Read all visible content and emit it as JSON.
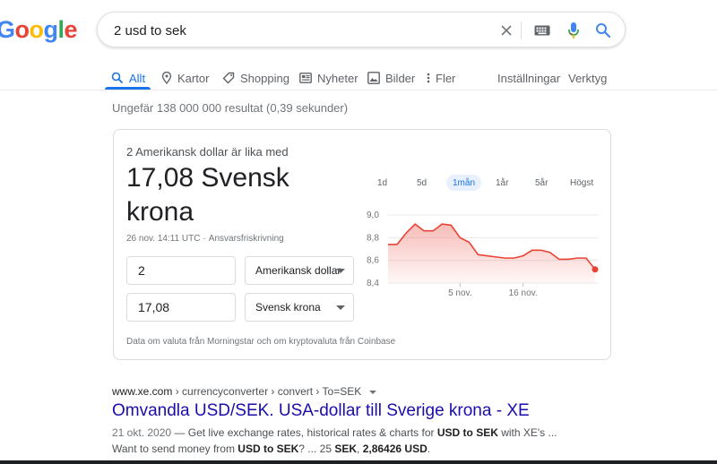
{
  "search": {
    "query": "2 usd to sek"
  },
  "tabs": [
    {
      "label": "Allt",
      "icon": "search-icon",
      "active": true
    },
    {
      "label": "Kartor",
      "icon": "map-pin-icon"
    },
    {
      "label": "Shopping",
      "icon": "tag-icon"
    },
    {
      "label": "Nyheter",
      "icon": "news-icon"
    },
    {
      "label": "Bilder",
      "icon": "image-icon"
    },
    {
      "label": "Fler",
      "icon": "more-vert-icon"
    }
  ],
  "tools": {
    "settings": "Inställningar",
    "tools": "Verktyg"
  },
  "stats": "Ungefär 138 000 000 resultat (0,39 sekunder)",
  "converter": {
    "equal_label": "2 Amerikansk dollar är lika med",
    "result": "17,08 Svensk krona",
    "timestamp": "26 nov. 14:11 UTC",
    "disclaimer": "Ansvarsfriskrivning",
    "from_amount": "2",
    "from_currency": "Amerikansk dollar",
    "to_amount": "17,08",
    "to_currency": "Svensk krona",
    "ranges": [
      "1d",
      "5d",
      "1mån",
      "1år",
      "5år",
      "Högst"
    ],
    "active_range": "1mån",
    "source_note": "Data om valuta från Morningstar och om kryptovaluta från Coinbase"
  },
  "chart_data": {
    "type": "area",
    "x": [
      "26 okt.",
      "27 okt.",
      "28 okt.",
      "29 okt.",
      "30 okt.",
      "2 nov.",
      "3 nov.",
      "4 nov.",
      "5 nov.",
      "6 nov.",
      "9 nov.",
      "10 nov.",
      "11 nov.",
      "12 nov.",
      "13 nov.",
      "16 nov.",
      "17 nov.",
      "18 nov.",
      "19 nov.",
      "20 nov.",
      "23 nov.",
      "24 nov.",
      "25 nov.",
      "26 nov."
    ],
    "values": [
      8.74,
      8.74,
      8.84,
      8.92,
      8.86,
      8.86,
      8.92,
      8.91,
      8.8,
      8.76,
      8.65,
      8.64,
      8.63,
      8.62,
      8.62,
      8.64,
      8.69,
      8.69,
      8.67,
      8.61,
      8.61,
      8.62,
      8.62,
      8.52
    ],
    "yticks": [
      "9,0",
      "8,8",
      "8,6",
      "8,4"
    ],
    "ylim": [
      8.4,
      9.0
    ],
    "xticks": [
      {
        "label": "5 nov.",
        "index": 8
      },
      {
        "label": "16 nov.",
        "index": 15
      }
    ],
    "line_color": "#ea4335"
  },
  "result": {
    "host": "www.xe.com",
    "path": " › currencyconverter › convert › To=SEK",
    "title": "Omvandla USD/SEK. USA-dollar till Sverige krona - XE",
    "snippet_date": "21 okt. 2020",
    "snippet_line1": " — Get live exchange rates, historical rates & charts for ",
    "snippet_b1": "USD to SEK",
    "snippet_line1_end": " with XE's ...",
    "snippet_line2_a": "Want to send money from ",
    "snippet_b2": "USD to SEK",
    "snippet_line2_b": "? ... 25 ",
    "snippet_b3": "SEK",
    "snippet_line2_c": ", ",
    "snippet_b4": "2,86426",
    "snippet_line2_d": " ",
    "snippet_b5": "USD",
    "snippet_line2_e": "."
  },
  "colors": {
    "accent": "#1a73e8",
    "link": "#1a0dab",
    "chart_line": "#ea4335"
  }
}
